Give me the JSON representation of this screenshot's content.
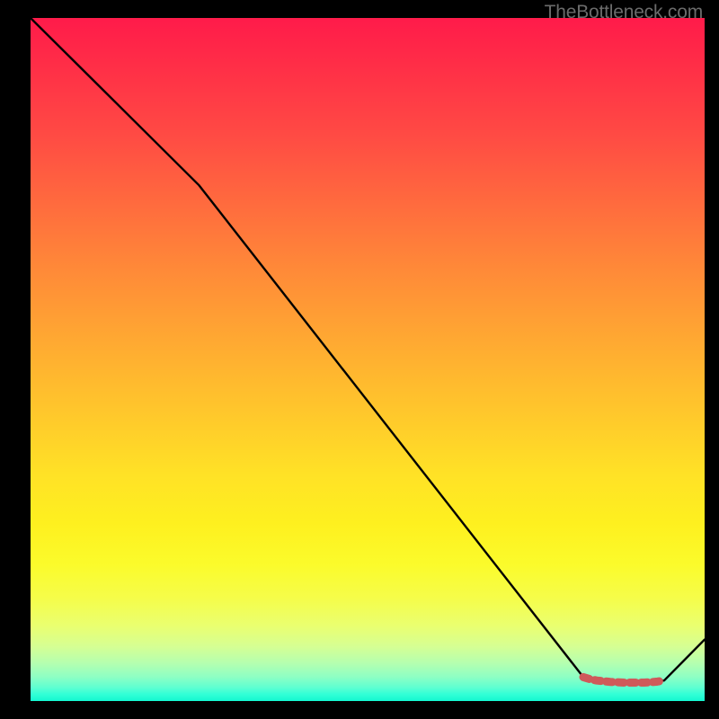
{
  "attribution": "TheBottleneck.com",
  "chart_data": {
    "type": "line",
    "title": "",
    "xlabel": "",
    "ylabel": "",
    "xlim": [
      0,
      100
    ],
    "ylim": [
      0,
      100
    ],
    "grid": false,
    "legend": false,
    "series": [
      {
        "name": "curve",
        "color": "#000000",
        "x": [
          0,
          25,
          82,
          83,
          84,
          85,
          86,
          87,
          88,
          89,
          90,
          91,
          92,
          93,
          94,
          100
        ],
        "values": [
          100,
          75.5,
          3.5,
          3.2,
          3.0,
          2.9,
          2.8,
          2.75,
          2.7,
          2.7,
          2.7,
          2.7,
          2.75,
          2.85,
          3.0,
          9
        ]
      },
      {
        "name": "highlight",
        "color": "#cf5a5a",
        "x": [
          82,
          83,
          84,
          85,
          86,
          87,
          88,
          89,
          90,
          91,
          92,
          93,
          94
        ],
        "values": [
          3.5,
          3.2,
          3.0,
          2.9,
          2.8,
          2.75,
          2.7,
          2.7,
          2.7,
          2.7,
          2.75,
          2.85,
          3.0
        ]
      }
    ],
    "colors": {
      "gradient_top": "#ff1b4a",
      "gradient_bottom": "#14f8d1",
      "highlight": "#cf5a5a"
    }
  }
}
